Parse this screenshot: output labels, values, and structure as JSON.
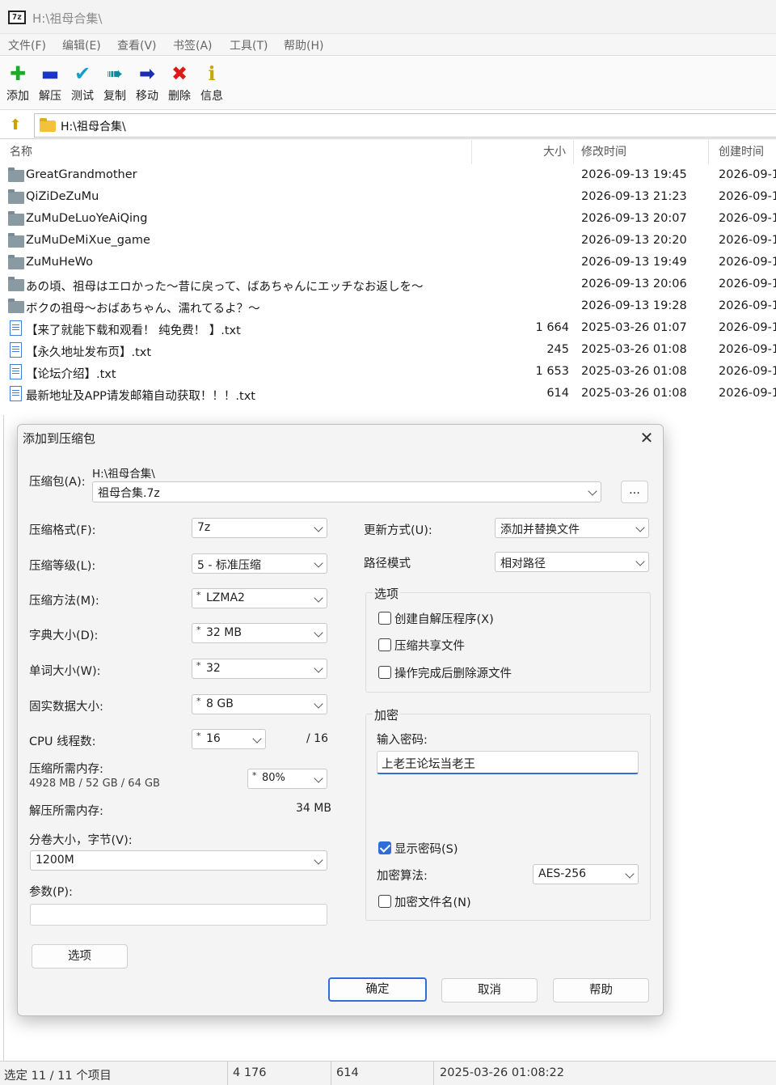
{
  "window": {
    "title": "H:\\祖母合集\\",
    "app_icon_text": "7z"
  },
  "menu": [
    "文件(F)",
    "编辑(E)",
    "查看(V)",
    "书签(A)",
    "工具(T)",
    "帮助(H)"
  ],
  "toolbar": [
    {
      "label": "添加",
      "icon": "add-plus-icon",
      "glyph": "✚",
      "color": "#1fa82a"
    },
    {
      "label": "解压",
      "icon": "extract-minus-icon",
      "glyph": "▬",
      "color": "#1a36c8"
    },
    {
      "label": "测试",
      "icon": "test-check-icon",
      "glyph": "✔",
      "color": "#16a0c8"
    },
    {
      "label": "复制",
      "icon": "copy-arrows-icon",
      "glyph": "➠",
      "color": "#0d8a9a"
    },
    {
      "label": "移动",
      "icon": "move-arrow-icon",
      "glyph": "➡",
      "color": "#1a2cb0"
    },
    {
      "label": "删除",
      "icon": "delete-x-icon",
      "glyph": "✖",
      "color": "#e01818"
    },
    {
      "label": "信息",
      "icon": "info-icon",
      "glyph": "ℹ",
      "color": "#c9a800"
    }
  ],
  "address": {
    "path": "H:\\祖母合集\\"
  },
  "list": {
    "headers": {
      "name": "名称",
      "size": "大小",
      "modified": "修改时间",
      "created": "创建时间"
    },
    "rows": [
      {
        "type": "folder",
        "name": "GreatGrandmother",
        "size": "",
        "modified": "2026-09-13 19:45",
        "created": "2026-09-1"
      },
      {
        "type": "folder",
        "name": "QiZiDeZuMu",
        "size": "",
        "modified": "2026-09-13 21:23",
        "created": "2026-09-1"
      },
      {
        "type": "folder",
        "name": "ZuMuDeLuoYeAiQing",
        "size": "",
        "modified": "2026-09-13 20:07",
        "created": "2026-09-1"
      },
      {
        "type": "folder",
        "name": "ZuMuDeMiXue_game",
        "size": "",
        "modified": "2026-09-13 20:20",
        "created": "2026-09-1"
      },
      {
        "type": "folder",
        "name": "ZuMuHeWo",
        "size": "",
        "modified": "2026-09-13 19:49",
        "created": "2026-09-1"
      },
      {
        "type": "folder",
        "name": "あの頃、祖母はエロかった～昔に戻って、ばあちゃんにエッチなお返しを～",
        "size": "",
        "modified": "2026-09-13 20:06",
        "created": "2026-09-1"
      },
      {
        "type": "folder",
        "name": "ボクの祖母～おばあちゃん、濡れてるよ？～",
        "size": "",
        "modified": "2026-09-13 19:28",
        "created": "2026-09-1"
      },
      {
        "type": "txt",
        "name": "【来了就能下载和观看！ 纯免费！ 】.txt",
        "size": "1 664",
        "modified": "2025-03-26 01:07",
        "created": "2026-09-1"
      },
      {
        "type": "txt",
        "name": "【永久地址发布页】.txt",
        "size": "245",
        "modified": "2025-03-26 01:08",
        "created": "2026-09-1"
      },
      {
        "type": "txt",
        "name": "【论坛介绍】.txt",
        "size": "1 653",
        "modified": "2025-03-26 01:08",
        "created": "2026-09-1"
      },
      {
        "type": "txt",
        "name": "最新地址及APP请发邮箱自动获取！！！.txt",
        "size": "614",
        "modified": "2025-03-26 01:08",
        "created": "2026-09-1"
      }
    ]
  },
  "dialog": {
    "title": "添加到压缩包",
    "archive_label": "压缩包(A):",
    "archive_dir": "H:\\祖母合集\\",
    "archive_name": "祖母合集.7z",
    "browse_label": "...",
    "format_label": "压缩格式(F):",
    "format_value": "7z",
    "level_label": "压缩等级(L):",
    "level_value": "5 - 标准压缩",
    "method_label": "压缩方法(M):",
    "method_value": "LZMA2",
    "dict_label": "字典大小(D):",
    "dict_value": "32 MB",
    "word_label": "单词大小(W):",
    "word_value": "32",
    "solid_label": "固实数据大小:",
    "solid_value": "8 GB",
    "cpu_label": "CPU 线程数:",
    "cpu_value": "16",
    "cpu_total": "/ 16",
    "mem_comp_label": "压缩所需内存:",
    "mem_comp_detail": "4928 MB / 52 GB / 64 GB",
    "mem_percent": "80%",
    "mem_decomp_label": "解压所需内存:",
    "mem_decomp_value": "34 MB",
    "volume_label": "分卷大小，字节(V):",
    "volume_value": "1200M",
    "params_label": "参数(P):",
    "params_value": "",
    "options_button": "选项",
    "update_label": "更新方式(U):",
    "update_value": "添加并替换文件",
    "path_label": "路径模式",
    "path_value": "相对路径",
    "options_group": "选项",
    "opt_sfx": "创建自解压程序(X)",
    "opt_shared": "压缩共享文件",
    "opt_delete": "操作完成后删除源文件",
    "enc_group": "加密",
    "password_label": "输入密码:",
    "password_value": "上老王论坛当老王",
    "show_password": "显示密码(S)",
    "enc_method_label": "加密算法:",
    "enc_method_value": "AES-256",
    "enc_names": "加密文件名(N)",
    "ok": "确定",
    "cancel": "取消",
    "help": "帮助"
  },
  "status": {
    "selected": "选定 11 / 11 个项目",
    "total_size": "4 176",
    "item_size": "614",
    "item_date": "2025-03-26 01:08:22"
  }
}
